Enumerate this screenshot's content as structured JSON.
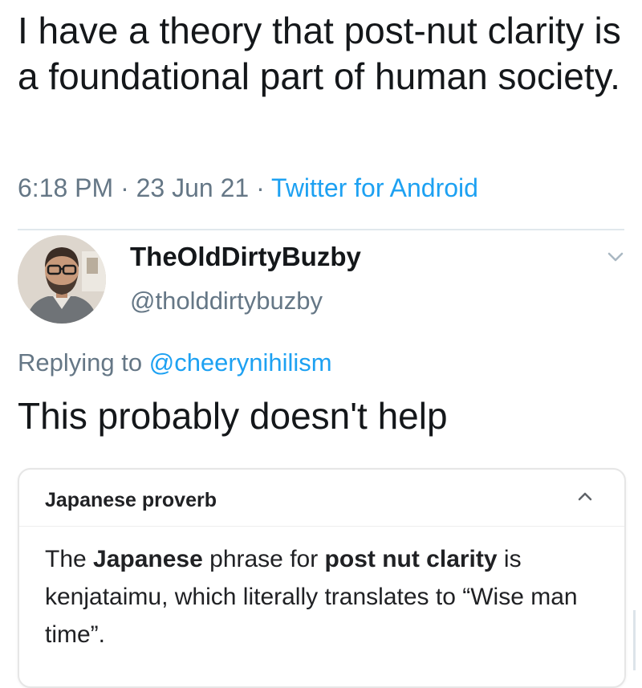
{
  "tweet": {
    "text": "I have a theory that post-nut clarity is a foundational part of human society.",
    "time": "6:18 PM",
    "date": "23 Jun 21",
    "separator": "·",
    "source": "Twitter for Android"
  },
  "reply": {
    "display_name": "TheOldDirtyBuzby",
    "handle": "@tholddirtybuzby",
    "replying_prefix": "Replying to",
    "replying_to": "@cheerynihilism",
    "text": "This probably doesn't help",
    "avatar_icon": "person-avatar-icon",
    "menu_icon": "chevron-down-icon"
  },
  "card": {
    "title": "Japanese proverb",
    "collapse_icon": "chevron-up-icon",
    "body": {
      "p1": "The ",
      "b1": "Japanese",
      "p2": " phrase for ",
      "b2": "post nut clarity",
      "p3": " is kenjataimu, which literally translates to “Wise man time”."
    }
  },
  "colors": {
    "text": "#14171a",
    "muted": "#657786",
    "link": "#1da1f2",
    "divider": "#e1e8ed"
  }
}
